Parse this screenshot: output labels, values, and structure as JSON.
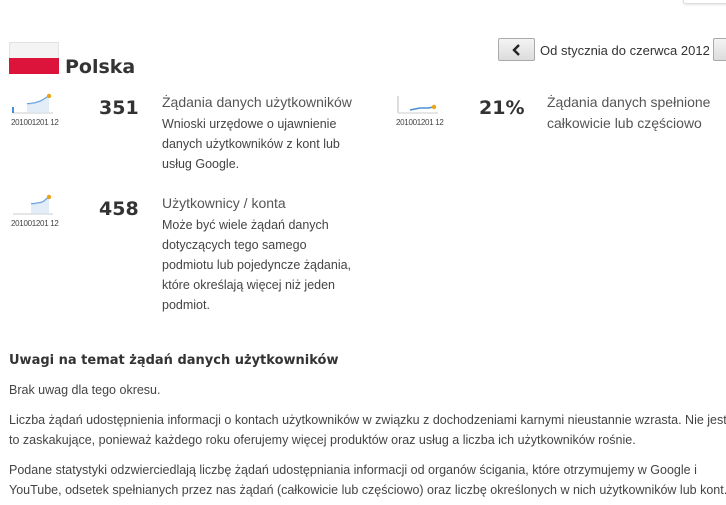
{
  "country": {
    "name": "Polska",
    "flag_icon": "flag-poland-icon"
  },
  "period_nav": {
    "label": "Od stycznia do czerwca 2012",
    "prev_icon": "chevron-left-icon"
  },
  "stats": {
    "requests": {
      "value": "351",
      "title": "Żądania danych użytkowników",
      "desc_lines": [
        "Wnioski urzędowe o ujawnienie",
        "danych użytkowników z kont lub",
        "usług Google."
      ],
      "spark_years": "201001201 12"
    },
    "complied": {
      "value": "21%",
      "title_lines": [
        "Żądania danych spełnione",
        "całkowicie lub częściowo"
      ],
      "spark_years": "201001201 12"
    },
    "accounts": {
      "value": "458",
      "title": "Użytkownicy / konta",
      "desc_lines": [
        "Może być wiele żądań danych",
        "dotyczących tego samego",
        "podmiotu lub pojedyncze żądania,",
        "które określają więcej niż jeden",
        "podmiot."
      ],
      "spark_years": "201001201 12"
    }
  },
  "notes": {
    "heading": "Uwagi na temat żądań danych użytkowników",
    "p1": "Brak uwag dla tego okresu.",
    "p2_lines": [
      "Liczba żądań udostępnienia informacji o kontach użytkowników w związku z dochodzeniami karnymi nieustannie wzrasta. Nie jest",
      "to zaskakujące, ponieważ każdego roku oferujemy więcej produktów oraz usług a liczba ich użytkowników rośnie."
    ],
    "p3_lines": [
      "Podane statystyki odzwierciedlają liczbę żądań udostępniania informacji od organów ścigania, które otrzymujemy w Google i",
      "YouTube, odsetek spełnianych przez nas żądań (całkowicie lub częściowo) oraz liczbę określonych w nich użytkowników lub kont."
    ]
  },
  "colors": {
    "accent_blue": "#4a90d9",
    "accent_orange": "#e8a317",
    "flag_red": "#dc143c"
  }
}
